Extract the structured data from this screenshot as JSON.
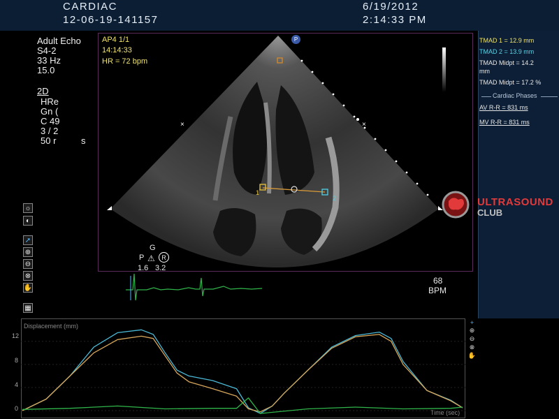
{
  "header": {
    "study": "CARDIAC",
    "patient_id": "12-06-19-141157",
    "date": "6/19/2012",
    "time": "2:14:33 PM"
  },
  "params": {
    "exam": "Adult Echo",
    "probe": "S4-2",
    "frame_rate": "33 Hz",
    "depth": "15.0",
    "mode": "2D",
    "res": "HRe",
    "gain": "Gn (",
    "compress": "C 49",
    "persist": "3 / 2",
    "dynamic": "50 r",
    "dynamic_suffix": "s"
  },
  "overlay": {
    "view": "AP4  1/1",
    "clock": "14:14:33",
    "hr": "HR = 72 bpm",
    "probe_badge": "P",
    "p_label": "P",
    "g_label": "G",
    "r_label": "R",
    "p_value": "1.6",
    "g_value": "3.2",
    "bpm_value": "68",
    "bpm_unit": "BPM",
    "caliper_1": "1",
    "caliper_2": "2"
  },
  "measurements": {
    "tmad1": "TMAD 1 = 12.9 mm",
    "tmad2": "TMAD 2 = 13.9 mm",
    "midpt_line1": "TMAD Midpt = 14.2",
    "midpt_line2": "mm",
    "midpt_pct": "TMAD Midpt = 17.2 %",
    "phases_header": "Cardiac Phases",
    "av_rr": "AV R-R = 831 ms",
    "mv_rr": "MV R-R = 831 ms"
  },
  "logo": {
    "line1": "ULTRASOUND",
    "line2": "CLUB"
  },
  "graph": {
    "ylabel": "Displacement (mm)",
    "xlabel": "Time (sec)",
    "yticks": [
      "12",
      "8",
      "4",
      "0"
    ]
  },
  "tools": {
    "brightness": "brightness-icon",
    "contrast": "contrast-icon",
    "pointer": "pointer-icon",
    "zoom_in": "zoom-in-icon",
    "zoom_out": "zoom-out-icon",
    "zoom_fit": "zoom-fit-icon",
    "pan": "pan-hand-icon",
    "scan": "scan-icon"
  },
  "colors": {
    "yellow_trace": "#d8a75a",
    "cyan_trace": "#4bb9d6",
    "green_trace": "#2fb54a",
    "header_bg": "#0b1e33",
    "measure_yellow": "#f1e46a",
    "measure_cyan": "#5cd3e6",
    "logo_red": "#e23a3a"
  },
  "chart_data": {
    "type": "line",
    "ylabel": "Displacement (mm)",
    "xlabel": "Time (sec)",
    "ylim": [
      0,
      15
    ],
    "series": [
      {
        "color": "cyan",
        "x": [
          0,
          0.1,
          0.2,
          0.3,
          0.4,
          0.5,
          0.55,
          0.6,
          0.65,
          0.7,
          0.8,
          0.9,
          0.95,
          1.0,
          1.05,
          1.1,
          1.2,
          1.3,
          1.4,
          1.5,
          1.55,
          1.6,
          1.7,
          1.8,
          1.85
        ],
        "values": [
          0,
          2,
          6,
          11,
          13.5,
          14,
          13.2,
          10,
          7,
          6,
          5.2,
          3.8,
          0.5,
          -0.5,
          0.8,
          3,
          7,
          11,
          13,
          13.6,
          12.5,
          8.5,
          3.5,
          1.8,
          0.5
        ]
      },
      {
        "color": "orange",
        "x": [
          0,
          0.1,
          0.2,
          0.3,
          0.4,
          0.5,
          0.55,
          0.6,
          0.65,
          0.7,
          0.8,
          0.9,
          0.95,
          1.0,
          1.05,
          1.1,
          1.2,
          1.3,
          1.4,
          1.5,
          1.55,
          1.6,
          1.7,
          1.8,
          1.85
        ],
        "values": [
          0,
          2,
          6,
          10,
          12.3,
          12.9,
          12.5,
          9.5,
          6.5,
          5,
          3.8,
          2.5,
          0.3,
          -0.2,
          0.8,
          3,
          7,
          10.8,
          12.8,
          13.2,
          12,
          8,
          3.5,
          1.7,
          0.5
        ]
      },
      {
        "color": "green",
        "x": [
          0,
          0.2,
          0.4,
          0.6,
          0.8,
          0.9,
          0.95,
          1.0,
          1.2,
          1.4,
          1.6,
          1.8,
          1.85
        ],
        "values": [
          0.2,
          0.4,
          0.8,
          0.3,
          0.4,
          0.4,
          2.2,
          -0.5,
          0.3,
          0.6,
          0.3,
          0.4,
          0.6
        ]
      }
    ]
  }
}
